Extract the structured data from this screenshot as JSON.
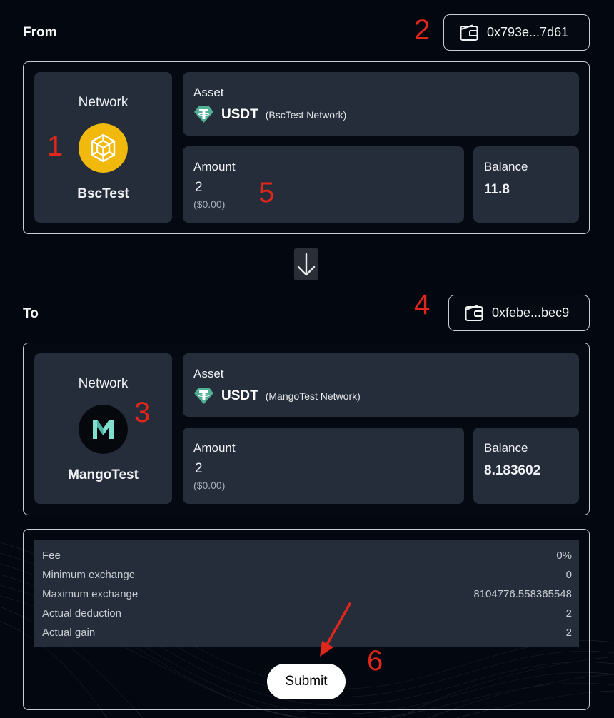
{
  "from": {
    "section_label": "From",
    "wallet_address": "0x793e...7d61",
    "network_title": "Network",
    "network_name": "BscTest",
    "asset_label": "Asset",
    "asset_name": "USDT",
    "asset_network": "(BscTest Network)",
    "amount_label": "Amount",
    "amount_value": "2",
    "amount_usd": "($0.00)",
    "balance_label": "Balance",
    "balance_value": "11.8"
  },
  "to": {
    "section_label": "To",
    "wallet_address": "0xfebe...bec9",
    "network_title": "Network",
    "network_name": "MangoTest",
    "asset_label": "Asset",
    "asset_name": "USDT",
    "asset_network": "(MangoTest Network)",
    "amount_label": "Amount",
    "amount_value": "2",
    "amount_usd": "($0.00)",
    "balance_label": "Balance",
    "balance_value": "8.183602"
  },
  "summary": {
    "rows": [
      {
        "label": "Fee",
        "value": "0%"
      },
      {
        "label": "Minimum exchange",
        "value": "0"
      },
      {
        "label": "Maximum exchange",
        "value": "8104776.558365548"
      },
      {
        "label": "Actual deduction",
        "value": "2"
      },
      {
        "label": "Actual gain",
        "value": "2"
      }
    ]
  },
  "submit_label": "Submit",
  "annotations": {
    "n1": "1",
    "n2": "2",
    "n3": "3",
    "n4": "4",
    "n5": "5",
    "n6": "6"
  },
  "colors": {
    "background": "#030810",
    "card": "#252d3a",
    "annotation": "#e1261c",
    "bnb_yellow": "#f0b90b",
    "usdt_green": "#50af95",
    "mango_teal": "#7fe0d0"
  },
  "icons": {
    "wallet": "wallet-icon",
    "bnb": "bnb-logo",
    "mango": "mango-logo",
    "usdt": "tether-icon",
    "swap": "arrow-down-icon"
  }
}
